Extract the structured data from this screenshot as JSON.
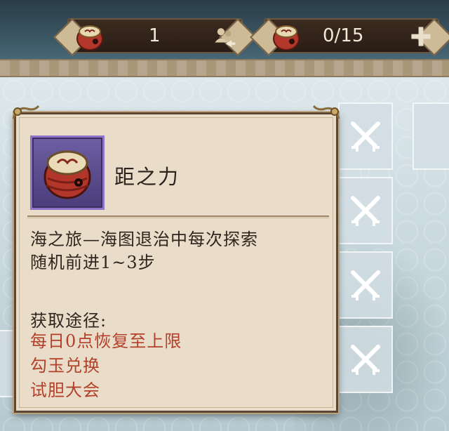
{
  "resources": {
    "drum_count": "1",
    "stamina": "0/15"
  },
  "item": {
    "name": "距之力",
    "description_lines": [
      "海之旅—海图退治中每次探索",
      "随机前进1~3步"
    ],
    "source_title": "获取途径:",
    "sources": [
      "每日0点恢复至上限",
      "勾玉兑换",
      "试胆大会"
    ]
  },
  "icons": {
    "drum": "drum-icon",
    "friends": "friends-share-icon",
    "plus": "plus-icon",
    "locked_slot": "crossed-swords-icon"
  },
  "colors": {
    "panel_bg": "#e9ddc9",
    "source_text": "#b3402a",
    "rarity_frame": "#8f73c8"
  }
}
